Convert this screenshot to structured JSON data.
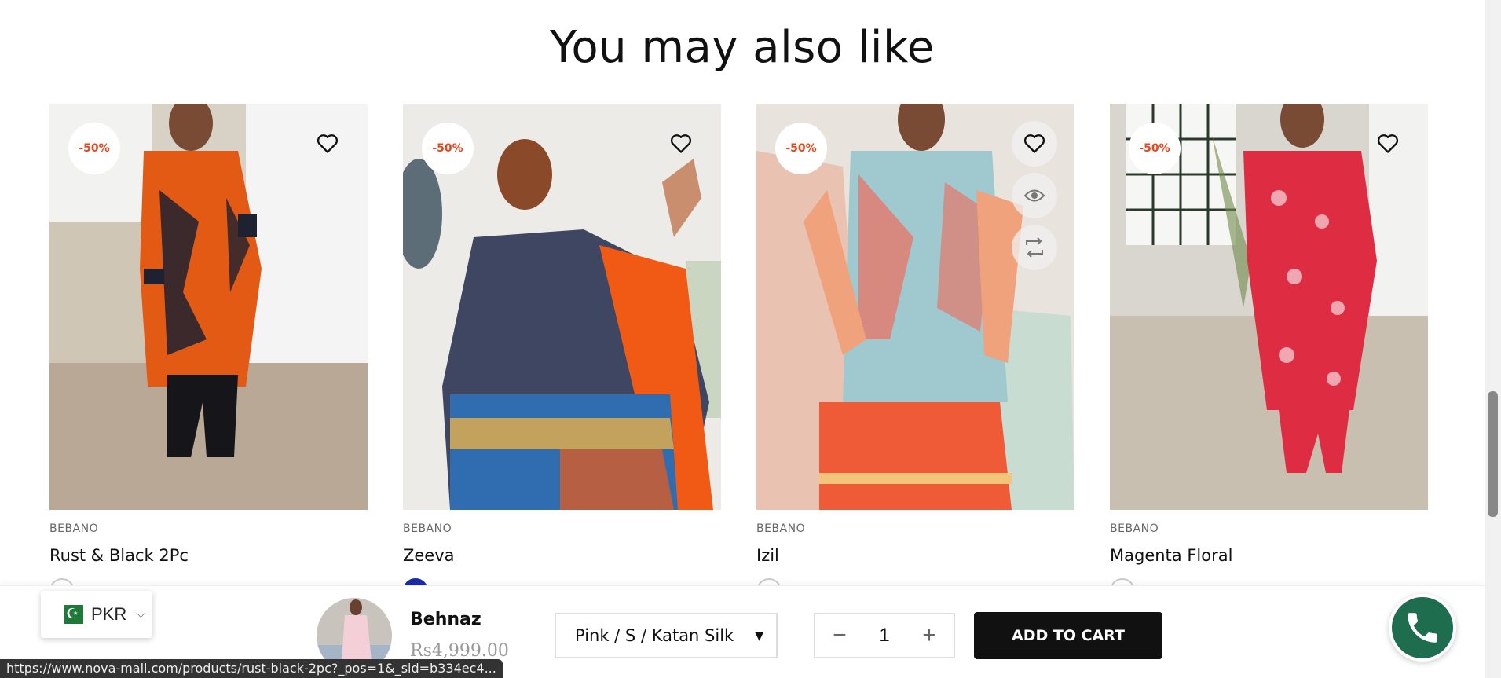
{
  "section": {
    "title": "You may also like"
  },
  "products": [
    {
      "badge": "-50%",
      "vendor": "BEBANO",
      "name": "Rust & Black 2Pc"
    },
    {
      "badge": "-50%",
      "vendor": "BEBANO",
      "name": "Zeeva"
    },
    {
      "badge": "-50%",
      "vendor": "BEBANO",
      "name": "Izil"
    },
    {
      "badge": "-50%",
      "vendor": "BEBANO",
      "name": "Magenta Floral"
    }
  ],
  "sticky": {
    "product_name": "Behnaz",
    "price": "Rs4,999.00",
    "variant": "Pink / S / Katan Silk",
    "quantity": "1",
    "qty_minus": "−",
    "qty_plus": "+",
    "add_to_cart": "ADD TO CART"
  },
  "currency": {
    "code": "PKR"
  },
  "status_bar": {
    "url": "https://www.nova-mall.com/products/rust-black-2pc?_pos=1&_sid=b334ec4..."
  },
  "colors": {
    "badge_text": "#e5461c",
    "button_bg": "#111111",
    "whatsapp": "#1f6d4f"
  }
}
